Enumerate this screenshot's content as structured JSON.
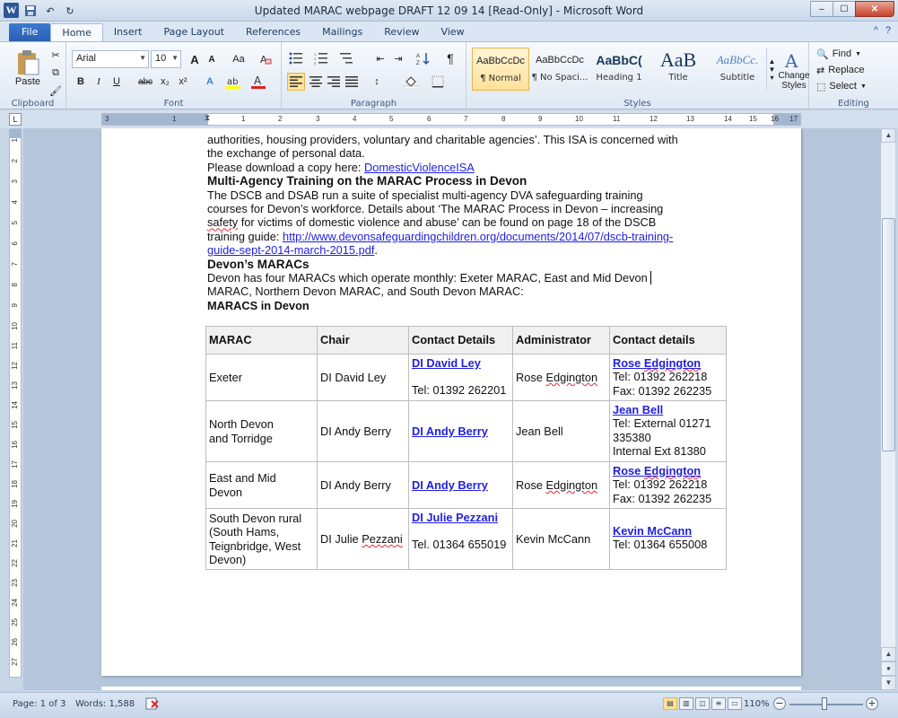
{
  "window": {
    "title": "Updated MARAC webpage DRAFT 12 09 14 [Read-Only]  -  Microsoft Word",
    "minimize": "–",
    "maximize": "☐",
    "close": "✕"
  },
  "qat": {
    "app_icon": "W",
    "save_icon": "💾",
    "undo_icon": "↶",
    "redo_icon": "↻"
  },
  "tabs": [
    "File",
    "Home",
    "Insert",
    "Page Layout",
    "References",
    "Mailings",
    "Review",
    "View"
  ],
  "help_icons": [
    "^",
    "?"
  ],
  "ribbon": {
    "clipboard": {
      "label": "Clipboard",
      "paste": "Paste"
    },
    "font": {
      "label": "Font",
      "font_name": "Arial",
      "font_size": "10",
      "grow": "A",
      "shrink": "A",
      "change_case": "Aa",
      "bold": "B",
      "italic": "I",
      "underline": "U",
      "strike": "abc",
      "sub": "x₂",
      "sup": "x²"
    },
    "paragraph": {
      "label": "Paragraph"
    },
    "styles": {
      "label": "Styles",
      "items": [
        {
          "sample": "AaBbCcDc",
          "name": "¶ Normal"
        },
        {
          "sample": "AaBbCcDc",
          "name": "¶ No Spaci..."
        },
        {
          "sample": "AaBbC(",
          "name": "Heading 1"
        },
        {
          "sample": "AaB",
          "name": "Title"
        },
        {
          "sample": "AaBbCc.",
          "name": "Subtitle"
        }
      ],
      "change_styles": "Change Styles"
    },
    "editing": {
      "label": "Editing",
      "find": "Find",
      "replace": "Replace",
      "select": "Select"
    }
  },
  "ruler": {
    "h_ticks": [
      "3",
      "1",
      "1",
      "2",
      "3",
      "4",
      "5",
      "6",
      "7",
      "8",
      "9",
      "10",
      "11",
      "12",
      "13",
      "14",
      "15",
      "16",
      "17"
    ],
    "v_ticks": [
      "1",
      "2",
      "3",
      "4",
      "5",
      "6",
      "7",
      "8",
      "9",
      "10",
      "11",
      "12",
      "13",
      "14",
      "15",
      "16",
      "17",
      "18",
      "19",
      "20",
      "21",
      "22",
      "23",
      "24",
      "25",
      "26",
      "27"
    ]
  },
  "document": {
    "line1": "authorities, housing providers, voluntary and charitable agencies’. This ISA is concerned with",
    "line2": "the exchange of personal data.",
    "download_prefix": "Please download a copy here: ",
    "download_link": "DomesticViolenceISA",
    "heading_training": "Multi-Agency  Training on the MARAC Process in Devon",
    "training_p1": "The DSCB and DSAB run a suite of specialist multi-agency DVA safeguarding training",
    "training_p2": "courses for Devon’s workforce. Details about ‘The MARAC Process in Devon – increasing",
    "training_p3_squig": "safety",
    "training_p3_rest": " for victims of domestic violence and abuse’ can be found on page 18 of the DSCB",
    "training_p4_prefix": "training guide:  ",
    "training_link_a": "http://www.devonsafeguardingchildren.org/documents/2014/07/dscb-training-",
    "training_link_b": "guide-sept-2014-march-2015.pdf",
    "training_end": ".",
    "heading_marac": "Devon’s MARACs",
    "marac_p1": "Devon has four MARACs which operate monthly: Exeter MARAC, East and Mid Devon",
    "marac_p2": "MARAC, Northern Devon MARAC, and South Devon MARAC:",
    "heading_maracs_in": "MARACS in Devon"
  },
  "table": {
    "headers": [
      "MARAC",
      "Chair",
      "Contact Details",
      "Administrator",
      "Contact details"
    ],
    "rows": [
      {
        "marac": "Exeter",
        "chair": "DI David Ley",
        "contact_link": "DI David Ley",
        "contact_tel": "Tel: 01392 262201",
        "admin_pre": "Rose ",
        "admin_squig": "Edgington",
        "admin_link_pre": "Rose ",
        "admin_link_squig": "Edgington",
        "admin_l2": "Tel: 01392 262218",
        "admin_l3": "Fax: 01392 262235"
      },
      {
        "marac_a": "North Devon",
        "marac_b": "and Torridge",
        "chair": "DI Andy Berry",
        "contact_link": "DI Andy Berry",
        "admin": "Jean Bell",
        "admin_link": "Jean Bell",
        "admin_l2": "Tel: External 01271",
        "admin_l3": "335380",
        "admin_l4": "Internal Ext 81380"
      },
      {
        "marac_a": "East and Mid",
        "marac_b": "Devon",
        "chair": "DI Andy Berry",
        "contact_link": "DI Andy Berry",
        "admin_pre": "Rose ",
        "admin_squig": "Edgington",
        "admin_link_pre": "Rose ",
        "admin_link_squig": "Edgington",
        "admin_l2": "Tel: 01392 262218",
        "admin_l3": "Fax: 01392 262235"
      },
      {
        "marac_a": "South Devon rural",
        "marac_b": "(South Hams,",
        "marac_c": "Teignbridge,  West",
        "marac_d": "Devon)",
        "chair_pre": "DI Julie ",
        "chair_squig": "Pezzani",
        "contact_link": "DI Julie Pezzani",
        "contact_tel": "Tel.  01364 655019",
        "admin": "Kevin McCann",
        "admin_link": "Kevin McCann",
        "admin_l2": "Tel:  01364 655008"
      }
    ]
  },
  "status": {
    "page": "Page: 1 of 3",
    "words": "Words: 1,588",
    "zoom": "110%"
  },
  "colors": {
    "accent": "#2b5797",
    "link": "#1f1fe0",
    "file_tab": "#2a5fb0"
  }
}
